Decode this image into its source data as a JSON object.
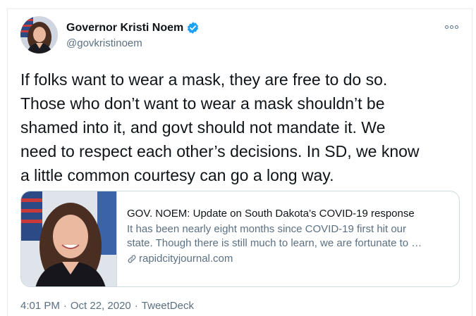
{
  "author": {
    "display_name": "Governor Kristi Noem",
    "handle": "@govkristinoem",
    "verified": true,
    "avatar_icon": "profile-photo"
  },
  "tweet": {
    "lines": [
      "If folks want to wear a mask, they are free to do so.",
      "Those who don’t want to wear a mask shouldn’t be",
      "shamed into it, and govt should not mandate it. We",
      "need to respect each other’s decisions. In SD, we know",
      "a little common courtesy can go a long way."
    ]
  },
  "link_card": {
    "title": "GOV. NOEM: Update on South Dakota’s COVID-19 response",
    "description_lines": [
      "It has been nearly eight months since COVID-19 first hit our",
      "state. Though there is still much to learn, we are fortunate to …"
    ],
    "domain": "rapidcityjournal.com",
    "link_icon": "link-icon"
  },
  "meta": {
    "time": "4:01 PM",
    "sep1": "·",
    "date": "Oct 22, 2020",
    "sep2": "·",
    "source": "TweetDeck"
  },
  "colors": {
    "verified_blue": "#1da1f2",
    "secondary_text": "#5b7083",
    "border": "#cfd9de"
  }
}
